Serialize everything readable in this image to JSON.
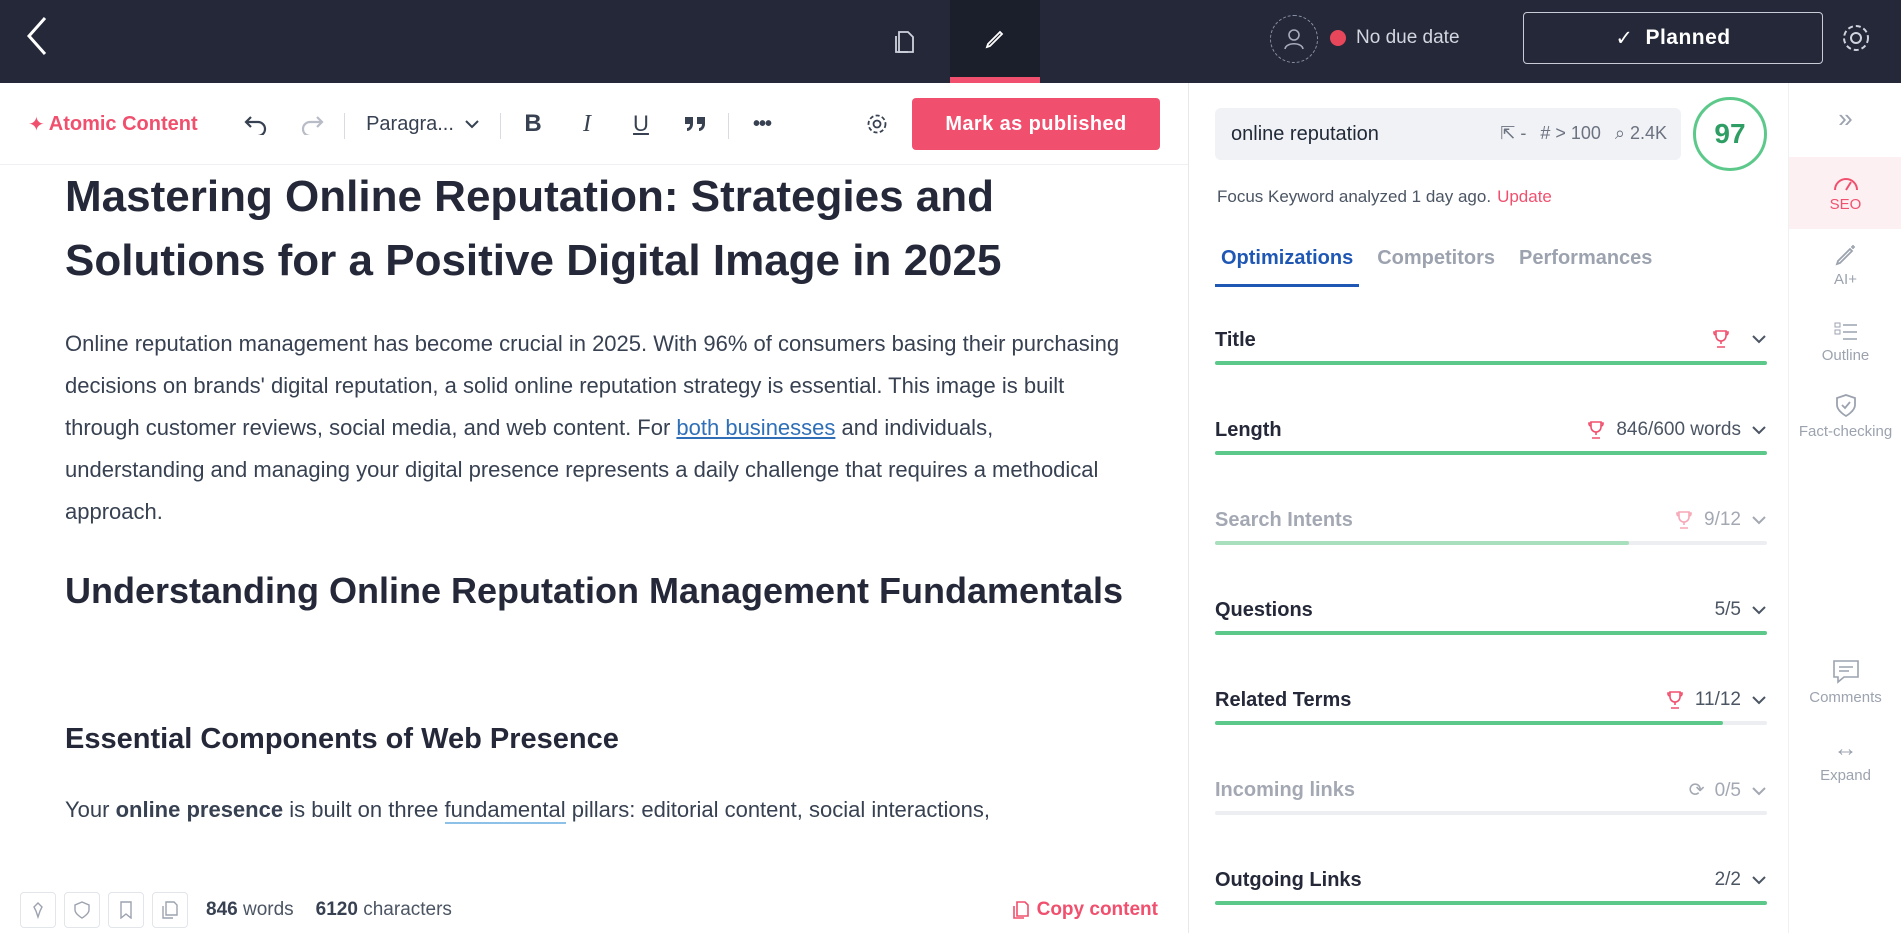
{
  "topbar": {
    "due_label": "No due date",
    "status_label": "Planned",
    "status_check": "✓"
  },
  "toolbar": {
    "atomic_label": "Atomic Content",
    "atomic_icon": "✦",
    "paragraph_label": "Paragra...",
    "bold": "B",
    "italic": "I",
    "underline": "U",
    "more": "•••",
    "mark_published": "Mark as published"
  },
  "document": {
    "title": "Mastering Online Reputation: Strategies and Solutions for a Positive Digital Image in 2025",
    "intro_1": "Online reputation management has become crucial in 2025. With 96% of consumers basing their purchasing decisions on brands' digital reputation, a solid online reputation strategy is essential. This image is built through customer reviews, social media, and web content. For ",
    "intro_link": "both businesses",
    "intro_2": " and individuals, understanding and managing your digital presence represents a daily challenge that requires a methodical approach.",
    "h2": "Understanding Online Reputation Management Fundamentals",
    "h3": "Essential Components of Web Presence",
    "p2_a": "Your ",
    "p2_b": "online presence",
    "p2_c": " is built on three ",
    "p2_d": "fundamental",
    "p2_e": " pillars: editorial content, social interactions,"
  },
  "statusbar": {
    "words": "846",
    "words_label": "words",
    "chars": "6120",
    "chars_label": "characters",
    "copy": "Copy content"
  },
  "seo": {
    "keyword": "online reputation",
    "meta_clicks": "-",
    "meta_rank": "> 100",
    "meta_volume": "2.4K",
    "score": "97",
    "analyzed": "Focus Keyword analyzed 1 day ago.",
    "update": "Update",
    "tabs": [
      "Optimizations",
      "Competitors",
      "Performances"
    ],
    "rows": [
      {
        "label": "Title",
        "value": "",
        "progress": 1.0
      },
      {
        "label": "Length",
        "value": "846/600 words",
        "progress": 1.0
      },
      {
        "label": "Search Intents",
        "value": "9/12",
        "progress": 0.75
      },
      {
        "label": "Questions",
        "value": "5/5",
        "progress": 1.0
      },
      {
        "label": "Related Terms",
        "value": "11/12",
        "progress": 0.92
      },
      {
        "label": "Incoming links",
        "value": "0/5",
        "progress": 0.0
      },
      {
        "label": "Outgoing Links",
        "value": "2/2",
        "progress": 1.0
      }
    ]
  },
  "rail": {
    "collapse": "»",
    "seo": "SEO",
    "ai": "AI+",
    "outline": "Outline",
    "fact": "Fact-checking",
    "comments": "Comments",
    "expand": "Expand",
    "expand_icon": "↔"
  },
  "colors": {
    "accent": "#f0506e",
    "topbar": "#242838",
    "success": "#5cc98a",
    "link": "#1f57b5"
  }
}
